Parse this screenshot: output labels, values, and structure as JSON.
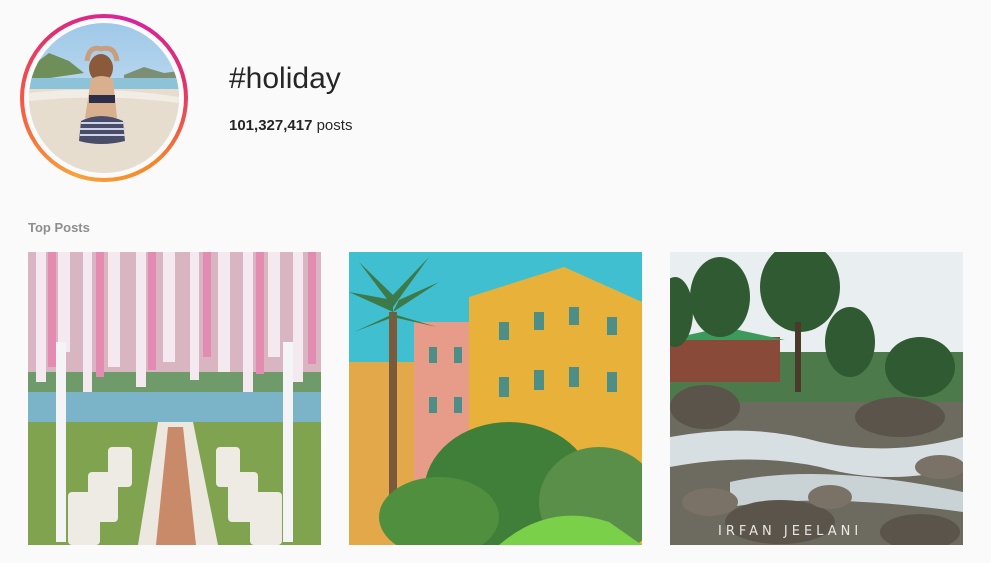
{
  "header": {
    "hashtag": "#holiday",
    "post_count": "101,327,417",
    "post_count_suffix": " posts"
  },
  "section": {
    "title": "Top Posts"
  },
  "posts": [
    {
      "name": "Flower-canopy banquet table"
    },
    {
      "name": "Yellow buildings with palm tree"
    },
    {
      "name": "Forest river with cabin",
      "watermark": "IRFAN JEELANI"
    }
  ]
}
